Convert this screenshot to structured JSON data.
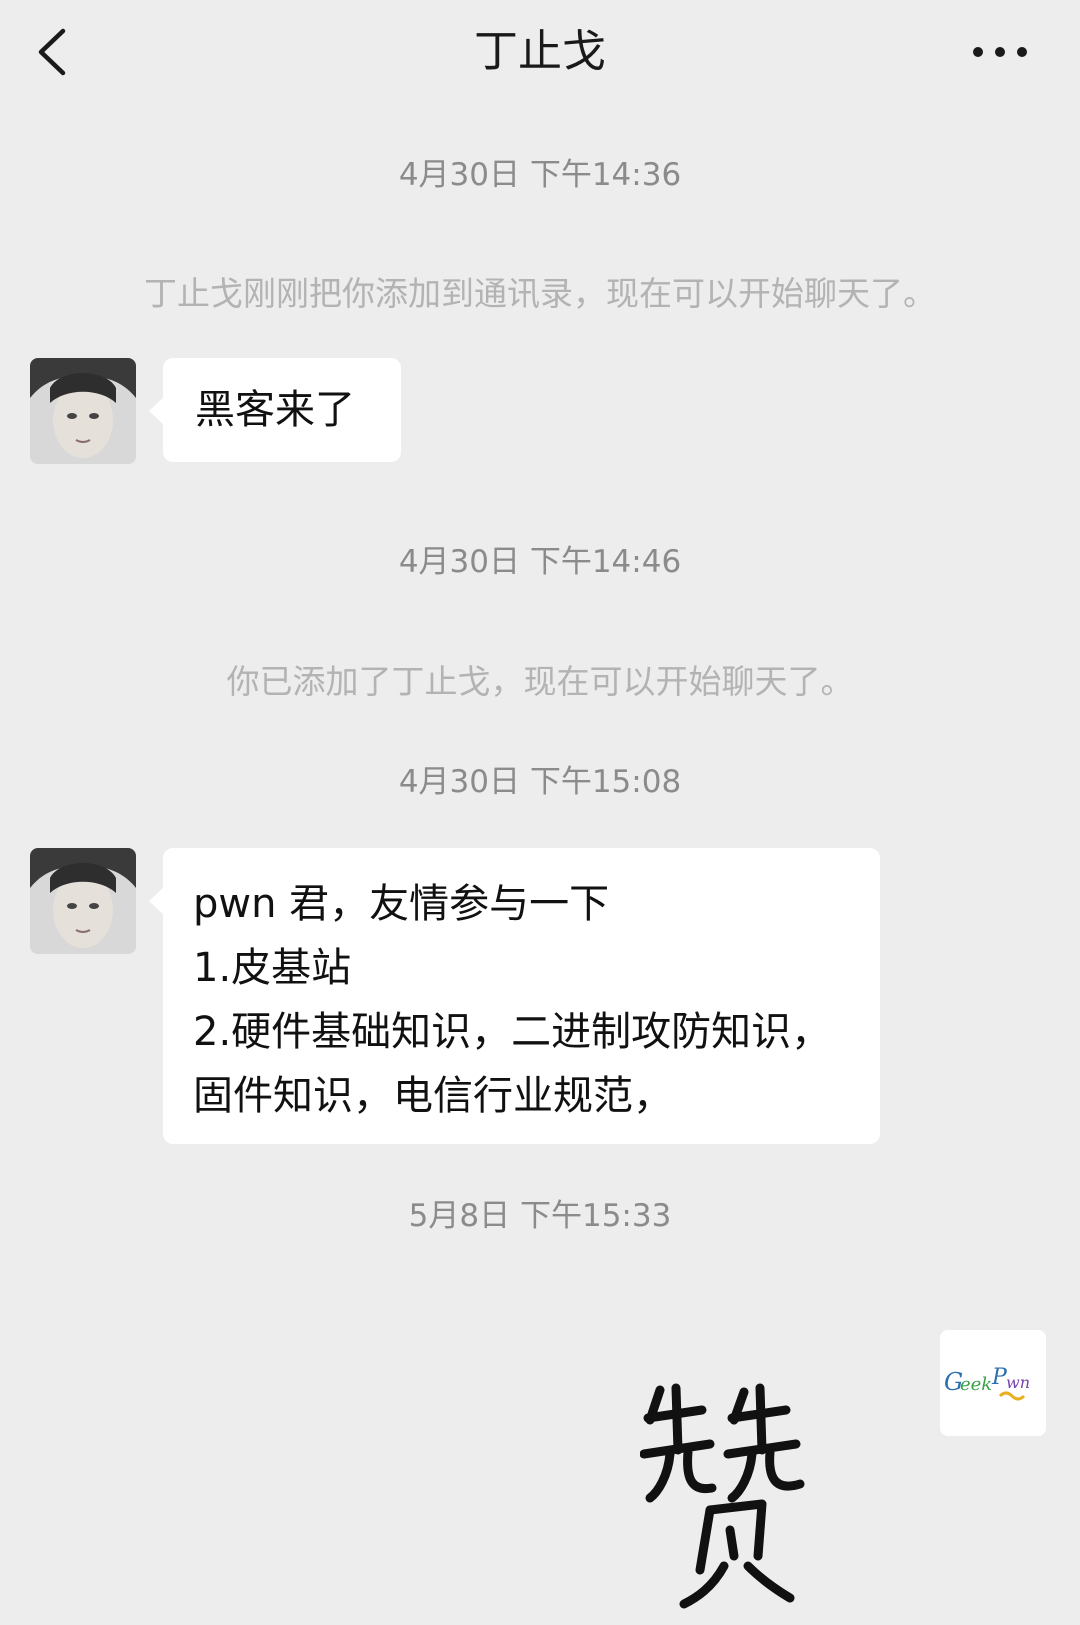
{
  "header": {
    "title": "丁止戈",
    "back_icon": "chevron-left-icon",
    "more_icon": "more-dots-icon"
  },
  "messages": {
    "ts1": "4月30日 下午14:36",
    "sys1": "丁止戈刚刚把你添加到通讯录，现在可以开始聊天了。",
    "msg1": "黑客来了",
    "ts2": "4月30日 下午14:46",
    "sys2": "你已添加了丁止戈，现在可以开始聊天了。",
    "ts3": "4月30日 下午15:08",
    "msg2_lines": [
      "pwn 君，友情参与一下",
      "1.皮基站",
      "2.硬件基础知识，二进制攻防知识，",
      "固件知识，电信行业规范，"
    ],
    "ts4": "5月8日 下午15:33"
  },
  "my_avatar": {
    "logo_text": "GeekPwn"
  },
  "sticker": {
    "icon": "handwritten-zan-sticker"
  },
  "colors": {
    "background": "#ededed",
    "bubble": "#ffffff",
    "timestamp": "#8b8b8b",
    "system_text": "#b3b3b3"
  }
}
